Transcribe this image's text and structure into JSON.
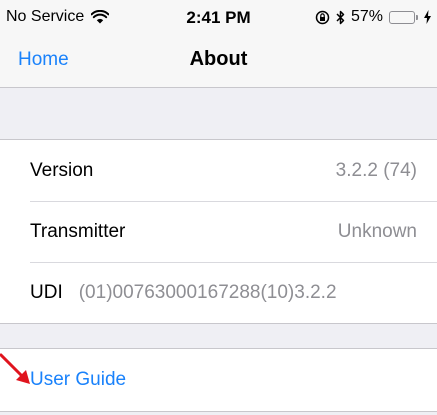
{
  "status_bar": {
    "carrier": "No Service",
    "time": "2:41 PM",
    "battery_percent": "57%",
    "battery_level": 0.57,
    "icons": [
      "wifi-icon",
      "orientation-lock-icon",
      "bluetooth-icon",
      "battery-icon",
      "charging-icon"
    ]
  },
  "nav": {
    "back_label": "Home",
    "title": "About"
  },
  "info": {
    "rows": [
      {
        "label": "Version",
        "value": "3.2.2 (74)"
      },
      {
        "label": "Transmitter",
        "value": "Unknown"
      },
      {
        "label": "UDI",
        "value": "(01)00763000167288(10)3.2.2"
      }
    ]
  },
  "links": {
    "user_guide": "User Guide"
  },
  "colors": {
    "accent": "#1a82fb",
    "battery": "#4cd964",
    "annotation_arrow": "#e0141e"
  }
}
